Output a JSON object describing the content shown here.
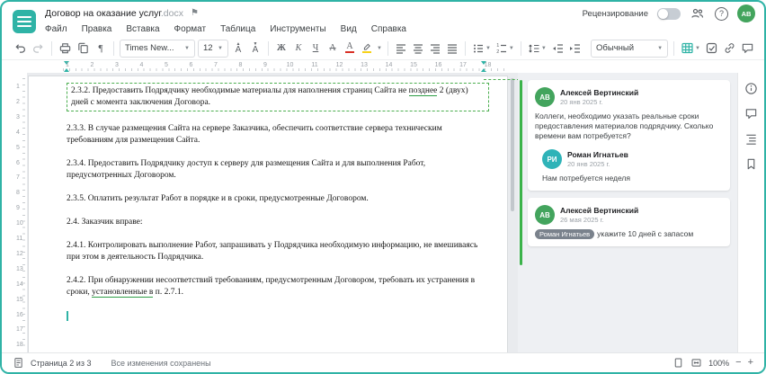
{
  "colors": {
    "accent": "#2FB3A6",
    "comment_green": "#3BB34A",
    "avatar_green": "#43A45D",
    "avatar_teal": "#2FB3B8"
  },
  "titlebar": {
    "title": "Договор на оказание услуг",
    "extension": ".docx",
    "review_label": "Рецензирование",
    "help_label": "?",
    "user_initials": "АВ"
  },
  "menu": {
    "items": [
      "Файл",
      "Правка",
      "Вставка",
      "Формат",
      "Таблица",
      "Инструменты",
      "Вид",
      "Справка"
    ]
  },
  "toolbar": {
    "font_family": "Times New...",
    "font_size": "12",
    "bold_label": "Ж",
    "italic_label": "К",
    "underline_label": "Ч",
    "strike_label": "А",
    "font_color_label": "А",
    "font_bigger_label": "А",
    "font_smaller_label": "А",
    "style_name": "Обычный"
  },
  "ruler": {
    "h_numbers": [
      1,
      2,
      3,
      4,
      5,
      6,
      7,
      8,
      9,
      10,
      11,
      12,
      13,
      14,
      15,
      16,
      17,
      18
    ],
    "v_numbers": [
      1,
      2,
      3,
      4,
      5,
      6,
      7,
      8,
      9,
      10,
      11,
      12,
      13,
      14,
      15,
      16,
      17,
      18
    ]
  },
  "document": {
    "paragraphs": [
      {
        "before": "2.3.2. Предоставить Подрядчику необходимые материалы для наполнения страниц Сайта не ",
        "marked": "позднее",
        "after": " 2 (двух) дней с момента заключения Договора."
      },
      {
        "text": "2.3.3. В случае размещения Сайта на сервере Заказчика, обеспечить соответствие сервера техническим требованиям для размещения Сайта."
      },
      {
        "text": "2.3.4. Предоставить Подрядчику доступ к серверу для размещения Сайта и для выполнения Работ, предусмотренных Договором."
      },
      {
        "text": "2.3.5. Оплатить результат Работ в порядке и в сроки, предусмотренные Договором."
      },
      {
        "text": "2.4. Заказчик вправе:"
      },
      {
        "text": "2.4.1. Контролировать выполнение Работ, запрашивать у Подрядчика необходимую информацию, не вмешиваясь при этом в деятельность Подрядчика."
      },
      {
        "before": "2.4.2. При обнаружении несоответствий требованиям, предусмотренным Договором, требовать их устранения в сроки, ",
        "marked": "установленные в",
        "after": " п. 2.7.1."
      }
    ]
  },
  "comments": {
    "threads": [
      {
        "author": "Алексей Вертинский",
        "initials": "АВ",
        "date": "20 янв 2025 г.",
        "text": "Коллеги, необходимо указать реальные сроки предоставления материалов подрядчику. Сколько времени вам потребуется?",
        "reply": {
          "author": "Роман Игнатьев",
          "initials": "РИ",
          "date": "20 янв 2025 г.",
          "text": "Нам потребуется неделя"
        }
      },
      {
        "author": "Алексей Вертинский",
        "initials": "АВ",
        "date": "26 мая 2025 г.",
        "mention": "Роман Игнатьев",
        "text": "укажите 10 дней с запасом"
      }
    ]
  },
  "status": {
    "page_label": "Страница 2 из 3",
    "saved_label": "Все изменения сохранены",
    "zoom": "100%",
    "zoom_out": "−",
    "zoom_in": "+"
  }
}
